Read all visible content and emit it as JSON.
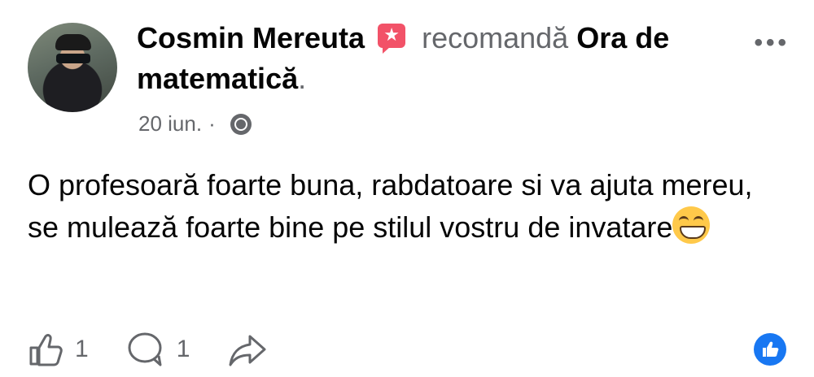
{
  "post": {
    "author": "Cosmin Mereuta",
    "recommends_word": "recomandă",
    "page_name": "Ora de matematică",
    "page_name_suffix": ".",
    "date": "20 iun.",
    "date_sep": "·",
    "privacy_icon": "globe-icon",
    "badge_icon": "star-badge-icon",
    "text": "O profesoară foarte buna, rabdatoare si va ajuta mereu, se mulează foarte bine pe stilul vostru de invatare",
    "emoji": "grinning-emoji"
  },
  "actions": {
    "like_count": "1",
    "comment_count": "1"
  },
  "colors": {
    "accent": "#1877f2",
    "recommend_badge": "#f25268",
    "secondary_text": "#65676b"
  }
}
